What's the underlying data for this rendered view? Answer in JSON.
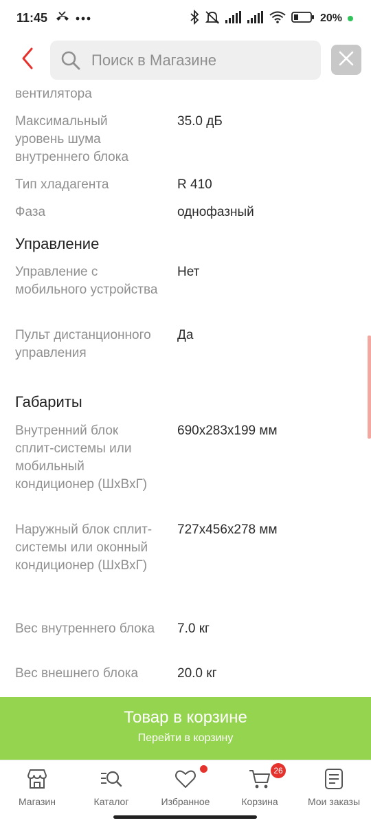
{
  "status_bar": {
    "time": "11:45",
    "battery": "20%",
    "icons": [
      "missed-call-icon",
      "more-dots-icon",
      "bluetooth-icon",
      "mute-icon",
      "signal-icon",
      "signal-icon",
      "wifi-icon",
      "battery-icon"
    ]
  },
  "search": {
    "placeholder": "Поиск в Магазине",
    "value": ""
  },
  "specs": {
    "top_partial_label": "вентилятора",
    "noise_label": "Максимальный уровень шума внутреннего блока",
    "noise_value": "35.0 дБ",
    "refrigerant_label": "Тип хладагента",
    "refrigerant_value": "R 410",
    "phase_label": "Фаза",
    "phase_value": "однофазный",
    "section_control": "Управление",
    "mobile_label": "Управление с мобильного устройства",
    "mobile_value": "Нет",
    "remote_label": "Пульт дистанционного управления",
    "remote_value": "Да",
    "section_dimensions": "Габариты",
    "indoor_dim_label": "Внутренний блок сплит-системы или мобильный кондиционер (ШхВхГ)",
    "indoor_dim_value": "690x283x199 мм",
    "outdoor_dim_label": "Наружный блок сплит-системы или оконный кондиционер (ШхВхГ)",
    "outdoor_dim_value": "727x456x278 мм",
    "indoor_weight_label": "Вес внутреннего блока",
    "indoor_weight_value": "7.0 кг",
    "outdoor_weight_label": "Вес внешнего блока",
    "outdoor_weight_value": "20.0 кг"
  },
  "cart_banner": {
    "title": "Товар в корзине",
    "subtitle": "Перейти в корзину"
  },
  "bottom_nav": {
    "items": [
      {
        "label": "Магазин",
        "icon": "store-icon"
      },
      {
        "label": "Каталог",
        "icon": "catalog-search-icon"
      },
      {
        "label": "Избранное",
        "icon": "heart-icon"
      },
      {
        "label": "Корзина",
        "icon": "cart-icon"
      },
      {
        "label": "Мои заказы",
        "icon": "orders-icon"
      }
    ],
    "cart_count": "26"
  },
  "colors": {
    "accent_red": "#e5322d",
    "banner_green": "#95d44e",
    "label_gray": "#8f8f8f"
  }
}
